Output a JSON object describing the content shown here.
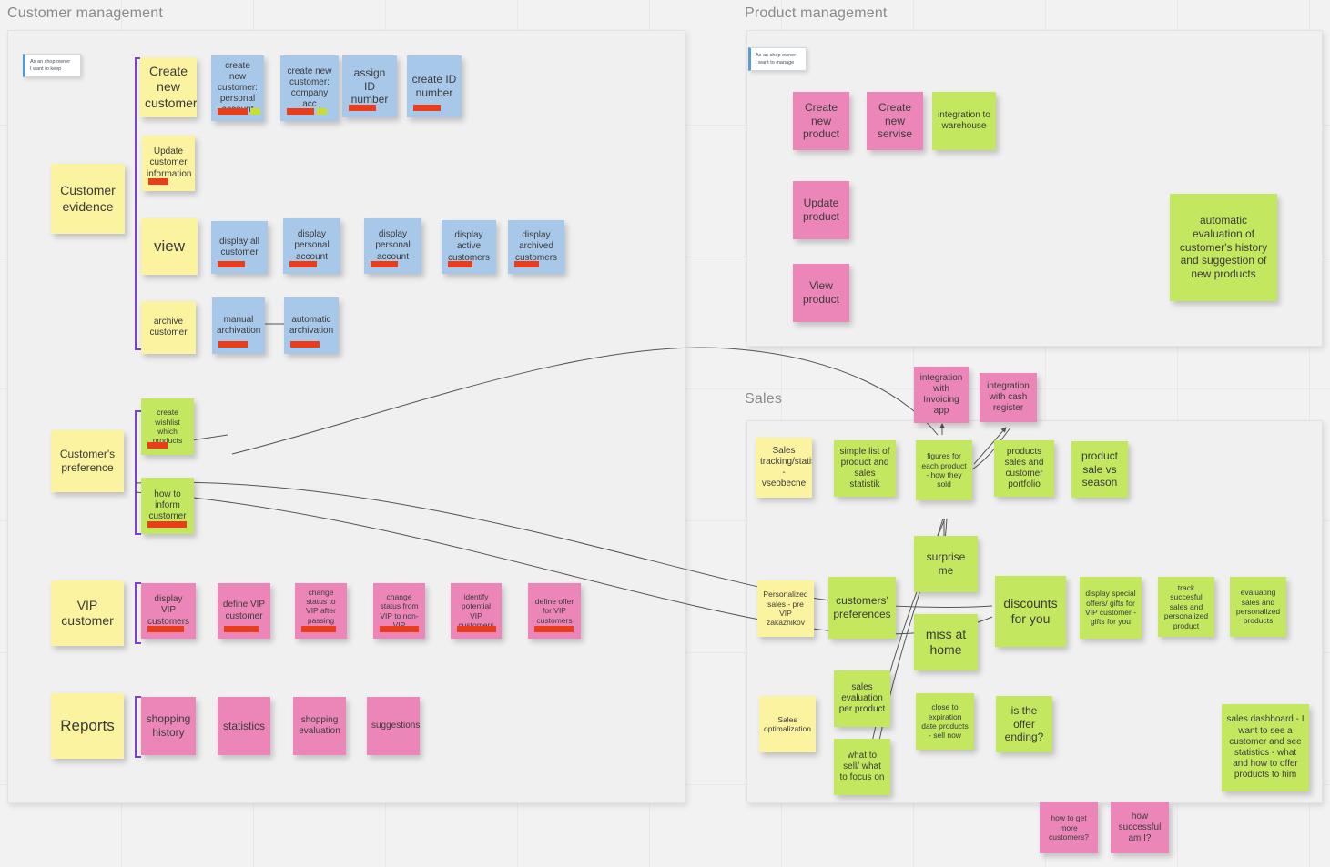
{
  "colors": {
    "canvas": "#f2f2f2",
    "frame_bg": "#f0f0f0",
    "yellow": "#fbf3a0",
    "blue": "#a8c8ea",
    "pink": "#ed86b8",
    "green": "#c3e860",
    "strip_red": "#ea3d1b",
    "strip_lime": "#c9dd36",
    "bracket_purple": "#7e3fd6",
    "story_accent": "#5b9bd5",
    "title_gray": "#8a8a8a"
  },
  "frames": [
    {
      "key": "customer_management",
      "title": "Customer management"
    },
    {
      "key": "product_management",
      "title": "Product management"
    },
    {
      "key": "sales",
      "title": "Sales"
    }
  ],
  "stories": [
    {
      "key": "cm_story",
      "line1": "As an shop owner",
      "line2": "I want to keep"
    },
    {
      "key": "pm_story",
      "line1": "As an shop owner",
      "line2": "I want to manage"
    }
  ],
  "customer_management": {
    "title": "Customer management",
    "story": "As an shop owner I want to keep",
    "epics": [
      {
        "label": "Customer evidence"
      },
      {
        "label": "Customer's preference"
      },
      {
        "label": "VIP customer"
      },
      {
        "label": "Reports"
      }
    ],
    "rows": [
      {
        "activity": "Create new customer",
        "cards": [
          "create new customer: personal account",
          "create new customer: company acc",
          "assign ID number",
          "create ID number"
        ]
      },
      {
        "activity": "Update customer information",
        "cards": []
      },
      {
        "activity": "view",
        "cards": [
          "display all customer",
          "display personal account",
          "display personal account",
          "display active customers",
          "display archived customers"
        ]
      },
      {
        "activity": "archive customer",
        "cards": [
          "manual archivation",
          "automatic archivation"
        ]
      },
      {
        "activity": "Customer's preference",
        "cards": [
          "create wishlist which products",
          "how to inform customer"
        ]
      },
      {
        "activity": "VIP customer",
        "cards": [
          "display VIP customers",
          "define VIP customer",
          "change status to VIP after passing condition",
          "change status from VIP to non-VIP",
          "identify potential VIP customers",
          "define offer for VIP customers"
        ]
      },
      {
        "activity": "Reports",
        "cards": [
          "shopping history",
          "statistics",
          "shopping evaluation",
          "suggestions"
        ]
      }
    ]
  },
  "product_management": {
    "title": "Product management",
    "story": "As an shop owner I want to manage",
    "cards": [
      "Create new product",
      "Create new servise",
      "integration to warehouse",
      "Update product",
      "View product",
      "automatic evaluation of customer's history and suggestion of new products"
    ]
  },
  "sales": {
    "title": "Sales",
    "outside_cards": [
      "integration with Invoicing app",
      "integration with cash register"
    ],
    "cards": [
      "Sales tracking/statistic - vseobecne",
      "simple list of product and sales statistik",
      "figures for each product - how they sold",
      "products sales and customer portfolio",
      "product sale vs season",
      "surprise me",
      "Personalized sales - pre VIP zakaznikov",
      "customers' preferences",
      "discounts for you",
      "display special offers/ gifts for VIP customer - gifts for you",
      "track succesful sales and personalized product",
      "evaluating sales and personalized products",
      "miss at home",
      "sales evaluation per product",
      "Sales optimalization",
      "close to expiration date products - sell now",
      "is the offer ending?",
      "what to sell/ what to focus on",
      "sales dashboard - I want to see a customer and see statistics - what and how to offer products to him"
    ],
    "bottom_cards": [
      "how to get more customers?",
      "how successful am I?"
    ]
  },
  "notes": {
    "n1": "Create new customer",
    "n2": "create new customer: personal account",
    "n3": "create new customer: company acc",
    "n4": "assign ID number",
    "n5": "create ID number",
    "n6": "Customer evidence",
    "n7": "Update customer information",
    "n8": "view",
    "n9": "display all customer",
    "n10": "display personal account",
    "n11": "display personal account",
    "n12": "display active customers",
    "n13": "display archived customers",
    "n14": "archive customer",
    "n15": "manual archivation",
    "n16": "automatic archivation",
    "n17": "Customer's preference",
    "n18": "create wishlist which products",
    "n19": "how to inform customer",
    "n20": "VIP customer",
    "n21": "display VIP customers",
    "n22": "define VIP customer",
    "n23": "change status to VIP after passing condition",
    "n24": "change status from VIP to non-VIP",
    "n25": "identify potential VIP customers",
    "n26": "define offer for VIP customers",
    "n27": "Reports",
    "n28": "shopping history",
    "n29": "statistics",
    "n30": "shopping evaluation",
    "n31": "suggestions",
    "p1": "Create new product",
    "p2": "Create new servise",
    "p3": "integration to warehouse",
    "p4": "Update product",
    "p5": "View product",
    "p6": "automatic evaluation of customer's history and suggestion of new products",
    "s1": "integration with Invoicing app",
    "s2": "integration with cash register",
    "s3": "Sales tracking/statistic - vseobecne",
    "s4": "simple list of product and sales statistik",
    "s5": "figures for each product - how they sold",
    "s6": "products sales and customer portfolio",
    "s7": "product sale vs season",
    "s8": "surprise me",
    "s9": "Personalized sales - pre VIP zakaznikov",
    "s10": "customers' preferences",
    "s11": "discounts for you",
    "s12": "display special offers/ gifts for VIP customer - gifts for you",
    "s13": "track succesful sales and personalized product",
    "s14": "evaluating sales and personalized products",
    "s15": "miss at home",
    "s16": "sales evaluation per product",
    "s17": "Sales optimalization",
    "s18": "close to expiration date products - sell now",
    "s19": "is the offer ending?",
    "s20": "what to sell/ what to focus on",
    "s21": "sales dashboard - I want to see a customer and see statistics - what and how to offer products to him",
    "s22": "how to get more customers?",
    "s23": "how successful am I?"
  }
}
